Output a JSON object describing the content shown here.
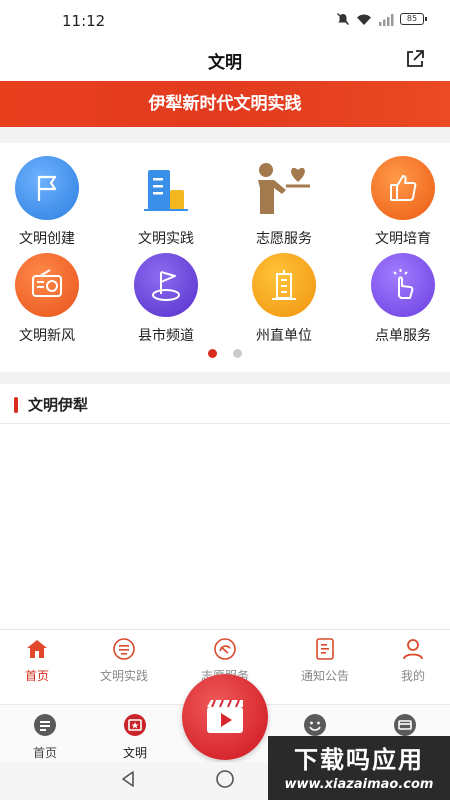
{
  "status_bar": {
    "time": "11:12",
    "battery": "85"
  },
  "header": {
    "title": "文明"
  },
  "banner": {
    "text": "伊犁新时代文明实践"
  },
  "grid": [
    {
      "label": "文明创建",
      "icon": "flag-icon",
      "color": "#3a8fe8"
    },
    {
      "label": "文明实践",
      "icon": "building-icon",
      "color": "#3a8fe8"
    },
    {
      "label": "志愿服务",
      "icon": "volunteer-icon",
      "color": "#a27a4d"
    },
    {
      "label": "文明培育",
      "icon": "thumbs-up-icon",
      "color": "#f26a1f"
    },
    {
      "label": "文明新风",
      "icon": "radio-icon",
      "color": "#f06a1f"
    },
    {
      "label": "县市频道",
      "icon": "map-flag-icon",
      "color": "#6b44d8"
    },
    {
      "label": "州直单位",
      "icon": "tower-icon",
      "color": "#f3a512"
    },
    {
      "label": "点单服务",
      "icon": "tap-icon",
      "color": "#7b4fe0"
    }
  ],
  "section": {
    "title": "文明伊犁"
  },
  "tabbar_top": [
    {
      "label": "首页",
      "icon": "home-icon"
    },
    {
      "label": "文明实践",
      "icon": "new-era-icon"
    },
    {
      "label": "志愿服务",
      "icon": "volunteer-service-icon"
    },
    {
      "label": "通知公告",
      "icon": "notice-icon"
    },
    {
      "label": "我的",
      "icon": "profile-icon"
    }
  ],
  "tabbar_bottom": [
    {
      "label": "首页",
      "icon": "home-chat-icon"
    },
    {
      "label": "文明",
      "icon": "civilization-icon"
    }
  ],
  "watermark": {
    "main": "下载吗应用",
    "sub": "www.xiazaimao.com"
  },
  "colors": {
    "accent": "#d82d1e",
    "banner": "#e23a1e"
  }
}
